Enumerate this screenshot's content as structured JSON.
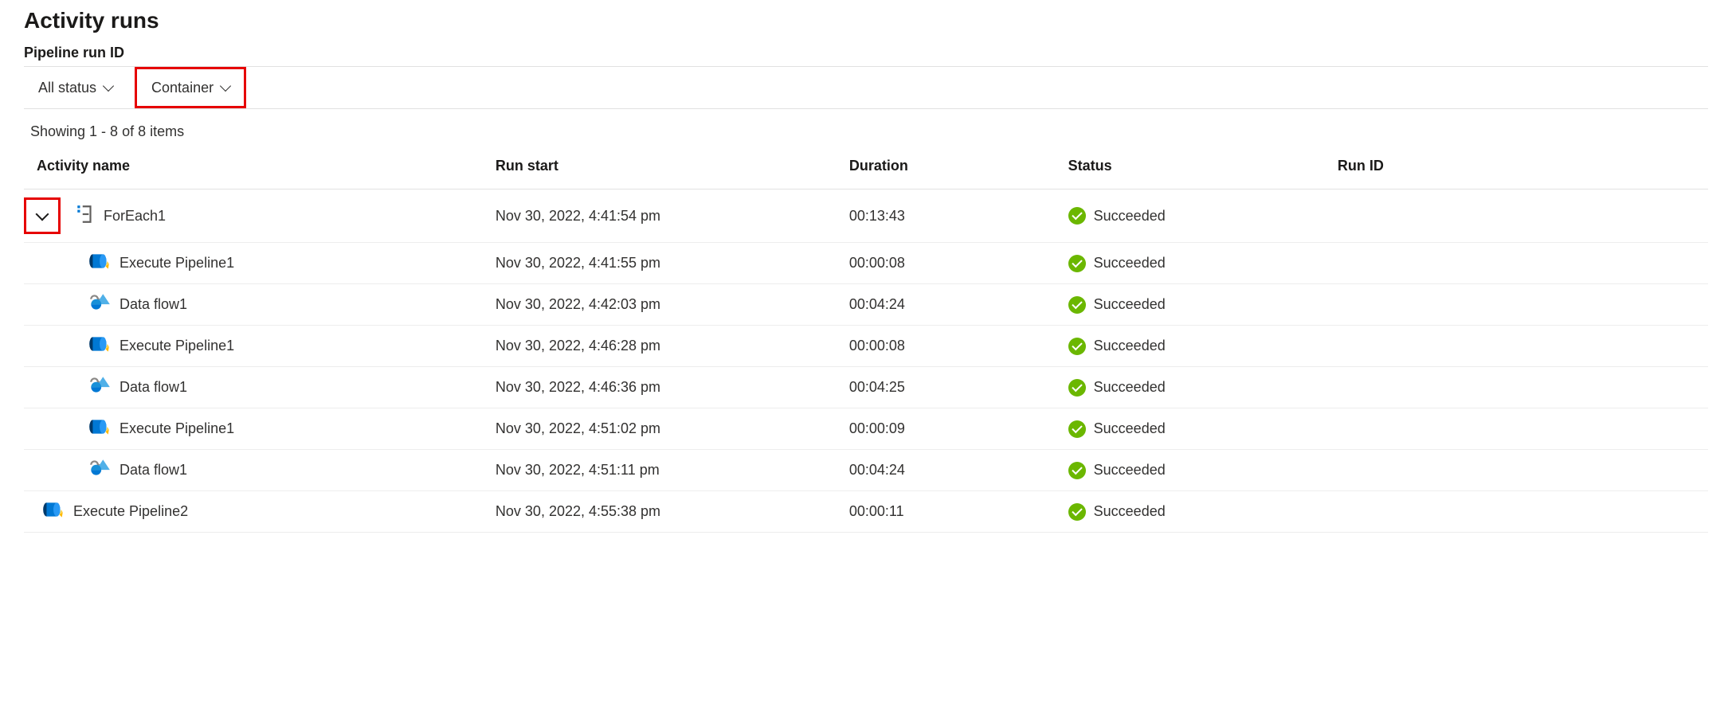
{
  "header": {
    "title": "Activity runs",
    "subtitle": "Pipeline run ID"
  },
  "filters": {
    "status": "All status",
    "container": "Container"
  },
  "count_text": "Showing 1 - 8 of 8 items",
  "columns": {
    "activity_name": "Activity name",
    "run_start": "Run start",
    "duration": "Duration",
    "status": "Status",
    "run_id": "Run ID"
  },
  "rows": [
    {
      "name": "ForEach1",
      "run_start": "Nov 30, 2022, 4:41:54 pm",
      "duration": "00:13:43",
      "status": "Succeeded",
      "icon": "foreach",
      "indent": 0,
      "expandable": true
    },
    {
      "name": "Execute Pipeline1",
      "run_start": "Nov 30, 2022, 4:41:55 pm",
      "duration": "00:00:08",
      "status": "Succeeded",
      "icon": "pipeline",
      "indent": 1
    },
    {
      "name": "Data flow1",
      "run_start": "Nov 30, 2022, 4:42:03 pm",
      "duration": "00:04:24",
      "status": "Succeeded",
      "icon": "dataflow",
      "indent": 1
    },
    {
      "name": "Execute Pipeline1",
      "run_start": "Nov 30, 2022, 4:46:28 pm",
      "duration": "00:00:08",
      "status": "Succeeded",
      "icon": "pipeline",
      "indent": 1
    },
    {
      "name": "Data flow1",
      "run_start": "Nov 30, 2022, 4:46:36 pm",
      "duration": "00:04:25",
      "status": "Succeeded",
      "icon": "dataflow",
      "indent": 1
    },
    {
      "name": "Execute Pipeline1",
      "run_start": "Nov 30, 2022, 4:51:02 pm",
      "duration": "00:00:09",
      "status": "Succeeded",
      "icon": "pipeline",
      "indent": 1
    },
    {
      "name": "Data flow1",
      "run_start": "Nov 30, 2022, 4:51:11 pm",
      "duration": "00:04:24",
      "status": "Succeeded",
      "icon": "dataflow",
      "indent": 1
    },
    {
      "name": "Execute Pipeline2",
      "run_start": "Nov 30, 2022, 4:55:38 pm",
      "duration": "00:00:11",
      "status": "Succeeded",
      "icon": "pipeline",
      "indent": 2
    }
  ]
}
